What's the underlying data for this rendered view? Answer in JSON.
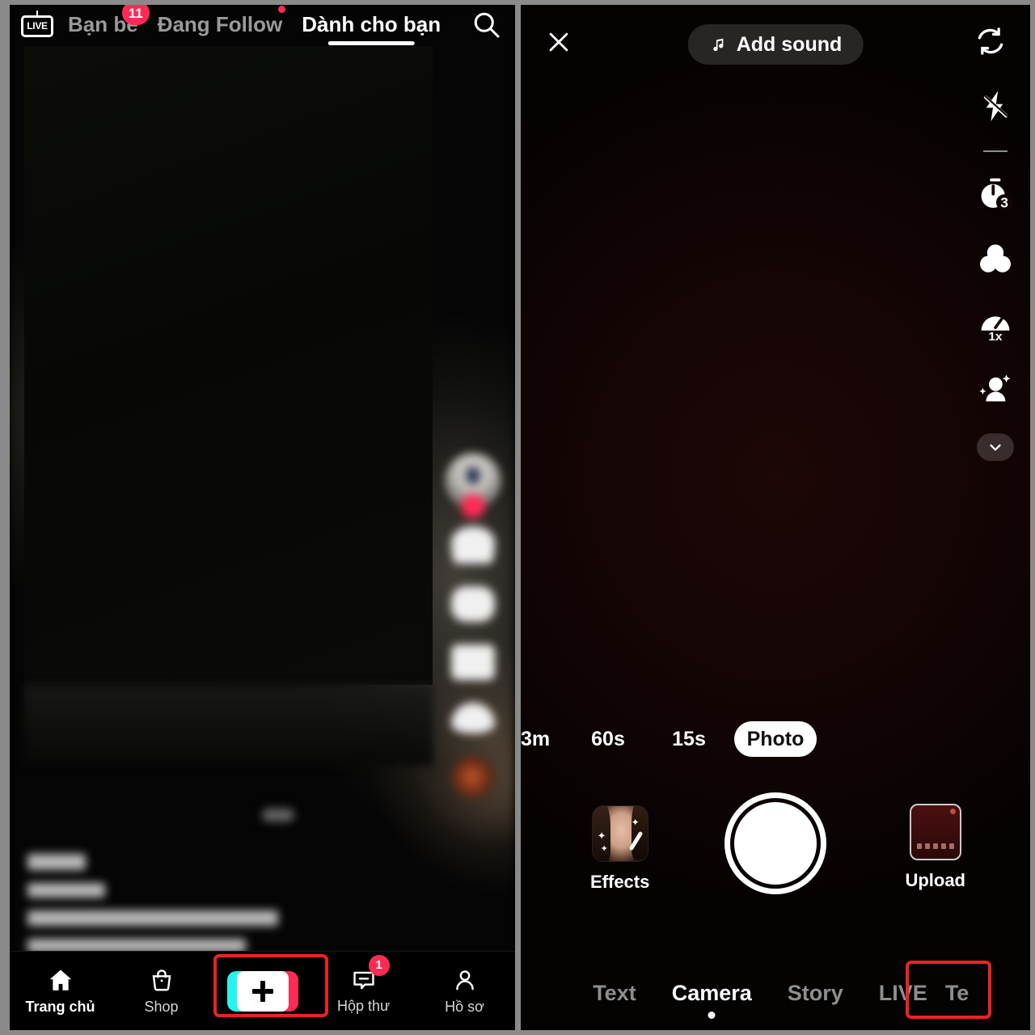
{
  "left_panel": {
    "top_tabs": {
      "live_icon_label": "LIVE",
      "items": [
        {
          "label": "Bạn bè",
          "active": false,
          "badge": "11"
        },
        {
          "label": "Đang Follow",
          "active": false,
          "badge_dot": true
        },
        {
          "label": "Dành cho bạn",
          "active": true
        }
      ],
      "search_icon": "search-icon"
    },
    "action_rail": {
      "items": [
        {
          "name": "like",
          "label": ""
        },
        {
          "name": "comment",
          "label": ""
        },
        {
          "name": "bookmark",
          "label": ""
        },
        {
          "name": "share",
          "label": ""
        },
        {
          "name": "sound-disc",
          "label": ""
        }
      ]
    },
    "bottom_nav": [
      {
        "label": "Trang chủ",
        "icon": "home-icon",
        "active": true
      },
      {
        "label": "Shop",
        "icon": "shop-bag-icon",
        "active": false
      },
      {
        "label": "",
        "icon": "plus-create-icon",
        "active": false,
        "highlighted": true
      },
      {
        "label": "Hộp thư",
        "icon": "inbox-message-icon",
        "active": false,
        "badge": "1"
      },
      {
        "label": "Hồ sơ",
        "icon": "profile-person-icon",
        "active": false
      }
    ]
  },
  "right_panel": {
    "top": {
      "close_icon": "close-icon",
      "add_sound_label": "Add sound",
      "music_icon": "music-note-icon",
      "flip_icon": "flip-camera-icon"
    },
    "side_tools": [
      {
        "name": "flash-off-icon",
        "label": ""
      },
      {
        "name": "timer-icon",
        "label": "3"
      },
      {
        "name": "filters-icon",
        "label": ""
      },
      {
        "name": "speed-icon",
        "label": "1x"
      },
      {
        "name": "beautify-icon",
        "label": ""
      },
      {
        "name": "chevron-down-icon",
        "label": ""
      }
    ],
    "durations": [
      {
        "label": "3m",
        "selected": false
      },
      {
        "label": "60s",
        "selected": false
      },
      {
        "label": "15s",
        "selected": false
      },
      {
        "label": "Photo",
        "selected": true
      }
    ],
    "effects_label": "Effects",
    "upload_label": "Upload",
    "shutter": "capture-button",
    "modes": [
      {
        "label": "Text",
        "active": false
      },
      {
        "label": "Camera",
        "active": true
      },
      {
        "label": "Story",
        "active": false
      },
      {
        "label": "LIVE",
        "active": false,
        "highlighted": true
      },
      {
        "label": "Te",
        "active": false,
        "clipped": true
      }
    ]
  },
  "colors": {
    "accent_pink": "#fe2c55",
    "accent_cyan": "#25f4ee",
    "highlight_box": "#ee2222",
    "panel_bg": "#000000"
  }
}
